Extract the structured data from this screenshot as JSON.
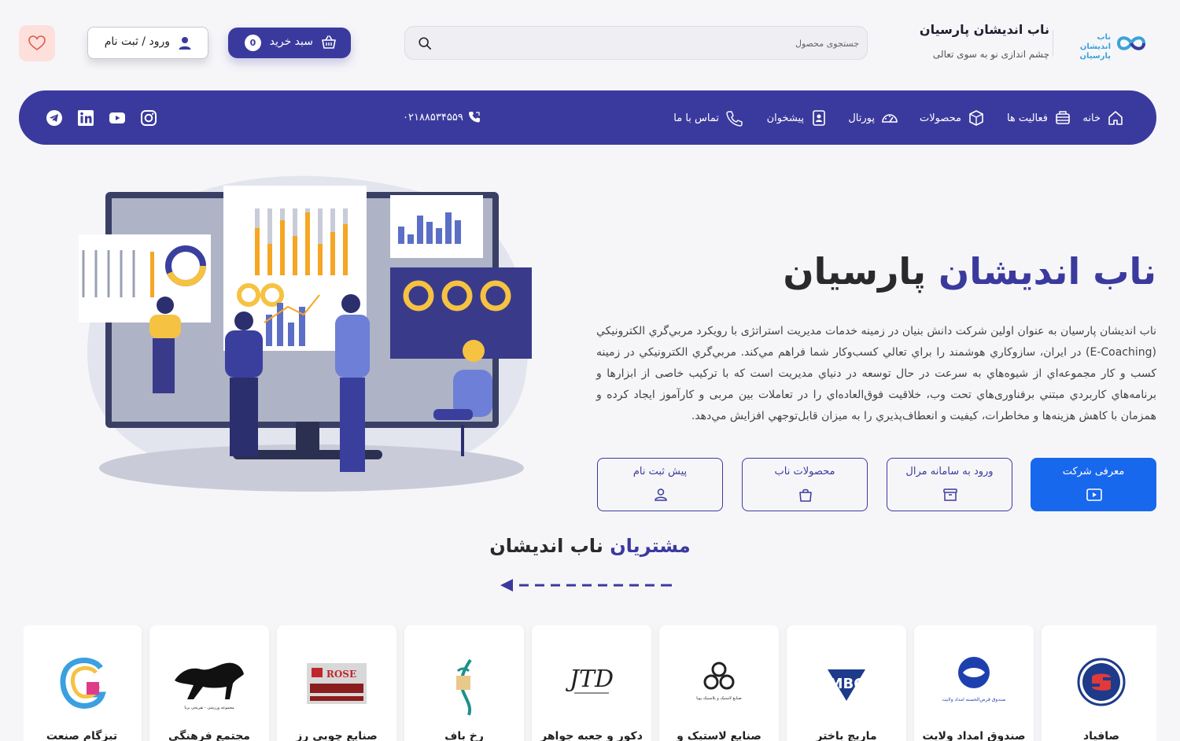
{
  "brand": {
    "title": "ناب اندیشان پارسیان",
    "subtitle": "چشم اندازی نو به سوی تعالی",
    "logo_text_line1": "ناب اندیشان",
    "logo_text_line2": "پارسیان"
  },
  "search": {
    "placeholder": "جستجوی محصول",
    "icon": "search-icon"
  },
  "cart": {
    "label": "سبد خرید",
    "count": "0"
  },
  "login": {
    "label": "ورود / ثبت نام"
  },
  "nav": {
    "items": [
      {
        "label": "خانه",
        "icon": "home-icon"
      },
      {
        "label": "فعالیت ها",
        "icon": "activities-icon"
      },
      {
        "label": "محصولات",
        "icon": "box-icon"
      },
      {
        "label": "پورتال",
        "icon": "dashboard-icon"
      },
      {
        "label": "پیشخوان",
        "icon": "id-card-icon"
      },
      {
        "label": "تماس با ما",
        "icon": "phone-icon"
      }
    ],
    "phone": "۰۲۱۸۸۵۳۴۵۵۹",
    "social": [
      "instagram-icon",
      "youtube-icon",
      "linkedin-icon",
      "telegram-icon"
    ]
  },
  "hero": {
    "title_blue": "ناب اندیشان",
    "title_dark": "پارسیان",
    "text": "ناب اندیشان پارسیان به عنوان اولین شرکت دانش بنیان در زمینه خدمات مدیریت استراتژی با رویکرد مربي‌گري الکترونیکي (E-Coaching) در ایران، سازوکاري هوشمند را براي تعالي کسب‌وکار شما فراهم مي‌کند. مربي‌گري الکترونیکي در زمینه کسب و کار مجموعه‌اي از شیوه‌هاي به سرعت در حال توسعه در دنیاي مدیریت است که با ترکیب خاصی از ابزارها و برنامه‌هاي کاربردي مبتني برفناوری‌هاي تحت وب، خلاقیت فوق‌العاده‌اي را در تعاملات بین مربی و کارآموز ایجاد کرده و همزمان با کاهش هزینه‌ها و مخاطرات، کیفیت و انعطاف‌پذیري را به میزان قابل‌توجهي افزایش مي‌دهد.",
    "actions": [
      {
        "label": "معرفی شرکت",
        "icon": "play-icon"
      },
      {
        "label": "ورود به سامانه مرال",
        "icon": "archive-icon"
      },
      {
        "label": "محصولات ناب",
        "icon": "bag-icon"
      },
      {
        "label": "پیش ثبت نام",
        "icon": "user-icon"
      }
    ]
  },
  "customers": {
    "title_blue": "مشتریان",
    "title_dark": "ناب اندیشان",
    "items": [
      {
        "name": "صافیاد",
        "logo_text": ""
      },
      {
        "name": "صندوق امداد ولایت",
        "logo_text": "صندوق قرض‌الحسنه امداد ولایت"
      },
      {
        "name": "ماریچ باختر",
        "logo_text": "MBC"
      },
      {
        "name": "صنایع لاستیک و",
        "logo_text": "صنایع لاستیک و پلاستیک پویا"
      },
      {
        "name": "دکور و جعبه جواهر",
        "logo_text": "JTD"
      },
      {
        "name": "رخ باف",
        "logo_text": ""
      },
      {
        "name": "صنایع چوبی رز",
        "logo_text": "ROSE"
      },
      {
        "name": "مجتمع فرهنگی",
        "logo_text": "مجموعه ورزشی - تفریحی برنا"
      },
      {
        "name": "تیزگام صنعت",
        "logo_text": ""
      }
    ]
  },
  "colors": {
    "primary": "#3a3a9e",
    "accent": "#1868ee",
    "favorite_bg": "#fde0dc",
    "chart_orange": "#f5a623"
  }
}
